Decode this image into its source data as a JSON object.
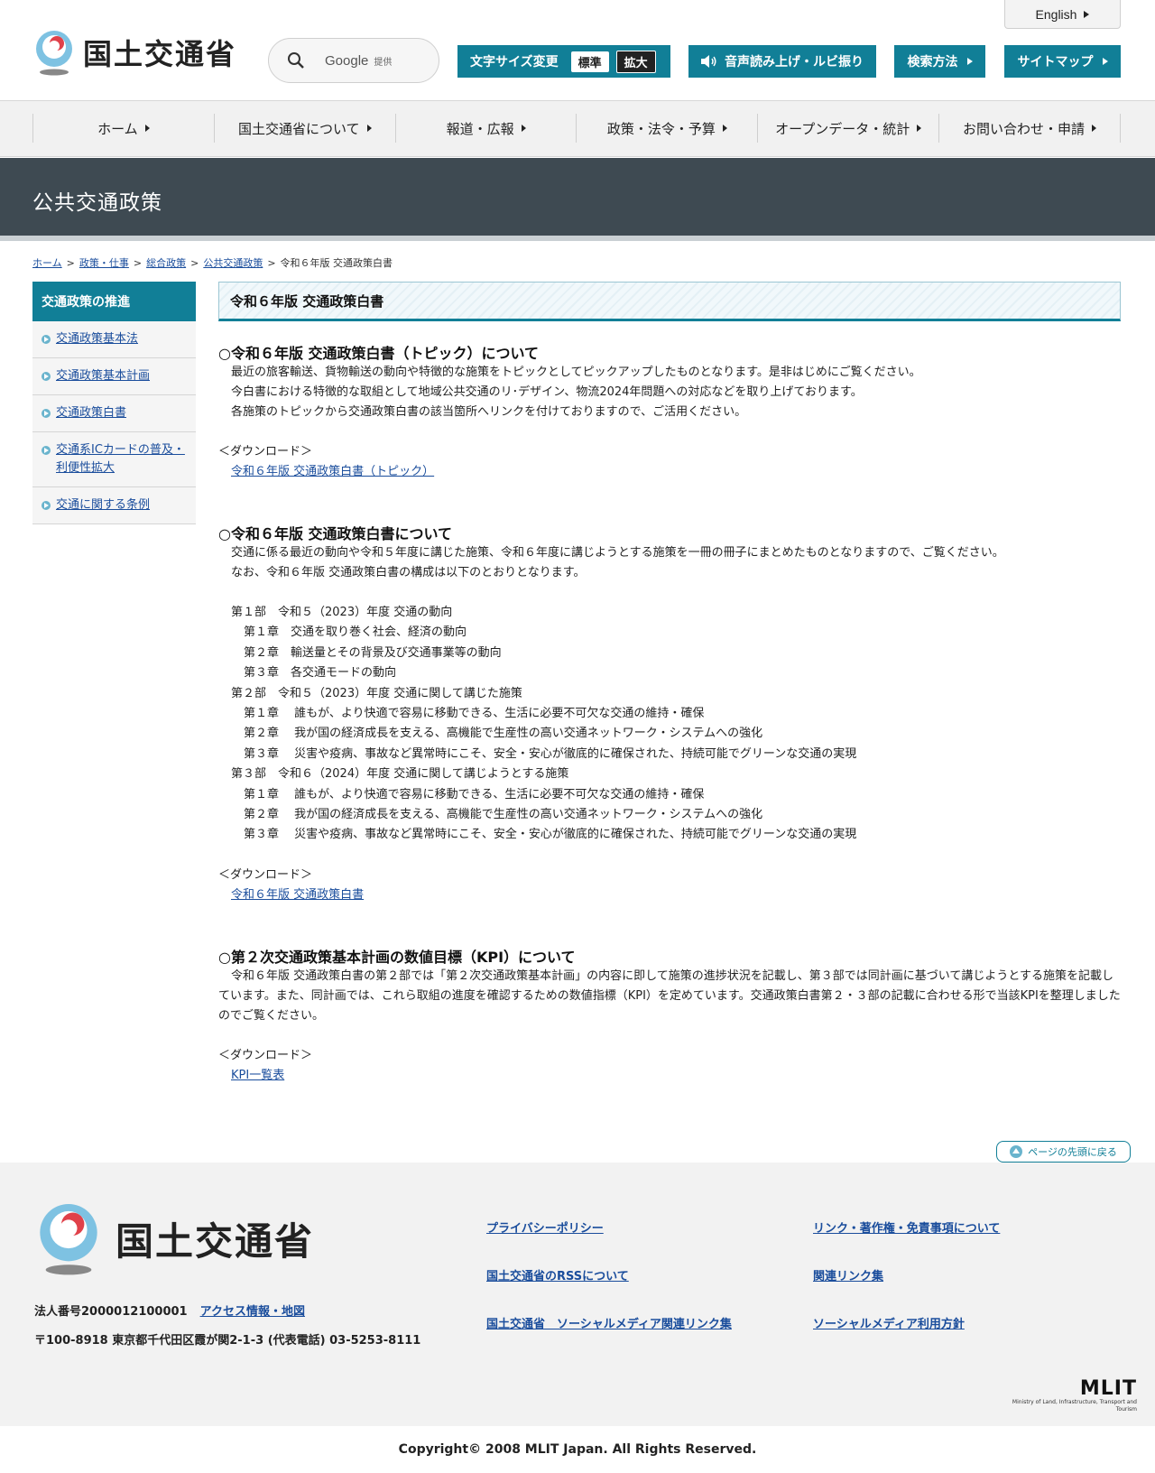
{
  "header": {
    "logo_text": "国土交通省",
    "search": {
      "provider": "Google",
      "provided_label": "提供"
    },
    "font_size": {
      "label": "文字サイズ変更",
      "standard": "標準",
      "large": "拡大"
    },
    "voice_label": "音声読み上げ・ルビ振り",
    "howto_label": "検索方法",
    "sitemap_label": "サイトマップ",
    "english_label": "English"
  },
  "nav": {
    "items": [
      {
        "label": "ホーム"
      },
      {
        "label": "国土交通省について"
      },
      {
        "label": "報道・広報"
      },
      {
        "label": "政策・法令・予算"
      },
      {
        "label": "オープンデータ・統計"
      },
      {
        "label": "お問い合わせ・申請"
      }
    ]
  },
  "page_title": "公共交通政策",
  "breadcrumb": {
    "items": [
      {
        "label": "ホーム"
      },
      {
        "label": "政策・仕事"
      },
      {
        "label": "総合政策"
      },
      {
        "label": "公共交通政策"
      }
    ],
    "current": "令和６年版 交通政策白書"
  },
  "sidebar": {
    "title": "交通政策の推進",
    "items": [
      {
        "label": "交通政策基本法"
      },
      {
        "label": "交通政策基本計画"
      },
      {
        "label": "交通政策白書"
      },
      {
        "label": "交通系ICカードの普及・利便性拡大"
      },
      {
        "label": "交通に関する条例"
      }
    ]
  },
  "main": {
    "heading": "令和６年版 交通政策白書",
    "download_label": "＜ダウンロード＞",
    "sections": [
      {
        "title": "○令和６年版 交通政策白書（トピック）について",
        "paragraphs": [
          "最近の旅客輸送、貨物輸送の動向や特徴的な施策をトピックとしてピックアップしたものとなります。是非はじめにご覧ください。",
          "今白書における特徴的な取組として地域公共交通のリ･デザイン、物流2024年問題への対応などを取り上げております。",
          "各施策のトピックから交通政策白書の該当箇所へリンクを付けておりますので、ご活用ください。"
        ],
        "link": "令和６年版 交通政策白書（トピック）"
      },
      {
        "title": "○令和６年版 交通政策白書について",
        "paragraphs": [
          "交通に係る最近の動向や令和５年度に講じた施策、令和６年度に講じようとする施策を一冊の冊子にまとめたものとなりますので、ご覧ください。",
          "なお、令和６年版 交通政策白書の構成は以下のとおりとなります。"
        ],
        "toc": [
          {
            "level": "part",
            "text": "第１部　令和５（2023）年度 交通の動向"
          },
          {
            "level": "chap",
            "text": "第１章　交通を取り巻く社会、経済の動向"
          },
          {
            "level": "chap",
            "text": "第２章　輸送量とその背景及び交通事業等の動向"
          },
          {
            "level": "chap",
            "text": "第３章　各交通モードの動向"
          },
          {
            "level": "part",
            "text": "第２部　令和５（2023）年度 交通に関して講じた施策"
          },
          {
            "level": "chap",
            "text": "第１章　 誰もが、より快適で容易に移動できる、生活に必要不可欠な交通の維持・確保"
          },
          {
            "level": "chap",
            "text": "第２章　 我が国の経済成長を支える、高機能で生産性の高い交通ネットワーク・システムへの強化"
          },
          {
            "level": "chap",
            "text": "第３章　 災害や疫病、事故など異常時にこそ、安全・安心が徹底的に確保された、持続可能でグリーンな交通の実現"
          },
          {
            "level": "part",
            "text": "第３部　令和６（2024）年度 交通に関して講じようとする施策"
          },
          {
            "level": "chap",
            "text": "第１章　 誰もが、より快適で容易に移動できる、生活に必要不可欠な交通の維持・確保"
          },
          {
            "level": "chap",
            "text": "第２章　 我が国の経済成長を支える、高機能で生産性の高い交通ネットワーク・システムへの強化"
          },
          {
            "level": "chap",
            "text": "第３章　 災害や疫病、事故など異常時にこそ、安全・安心が徹底的に確保された、持続可能でグリーンな交通の実現"
          }
        ],
        "link": "令和６年版 交通政策白書"
      },
      {
        "title": "○第２次交通政策基本計画の数値目標（KPI）について",
        "paragraphs": [
          "令和６年版 交通政策白書の第２部では「第２次交通政策基本計画」の内容に即して施策の進捗状況を記載し、第３部では同計画に基づいて講じようとする施策を記載しています。また、同計画では、これら取組の進度を確認するための数値指標（KPI）を定めています。交通政策白書第２・３部の記載に合わせる形で当該KPIを整理しましたのでご覧ください。"
        ],
        "link": "KPI一覧表"
      }
    ]
  },
  "back_to_top": "ページの先頭に戻る",
  "footer": {
    "logo_text": "国土交通省",
    "corp_number": "法人番号2000012100001",
    "access_link": "アクセス情報・地図",
    "address": "〒100-8918 東京都千代田区霞が関2-1-3 (代表電話) 03-5253-8111",
    "links_col1": [
      "プライバシーポリシー",
      "国土交通省のRSSについて",
      "国土交通省　ソーシャルメディア関連リンク集"
    ],
    "links_col2": [
      "リンク・著作権・免責事項について",
      "関連リンク集",
      "ソーシャルメディア利用方針"
    ],
    "mlit_logo": "MLIT",
    "mlit_sub": "Ministry of Land, Infrastructure, Transport and Tourism",
    "copyright": "Copyright© 2008 MLIT Japan. All Rights Reserved."
  },
  "colors": {
    "teal": "#117f97",
    "title_band": "#3e4a52",
    "link": "#1a4d9c"
  }
}
